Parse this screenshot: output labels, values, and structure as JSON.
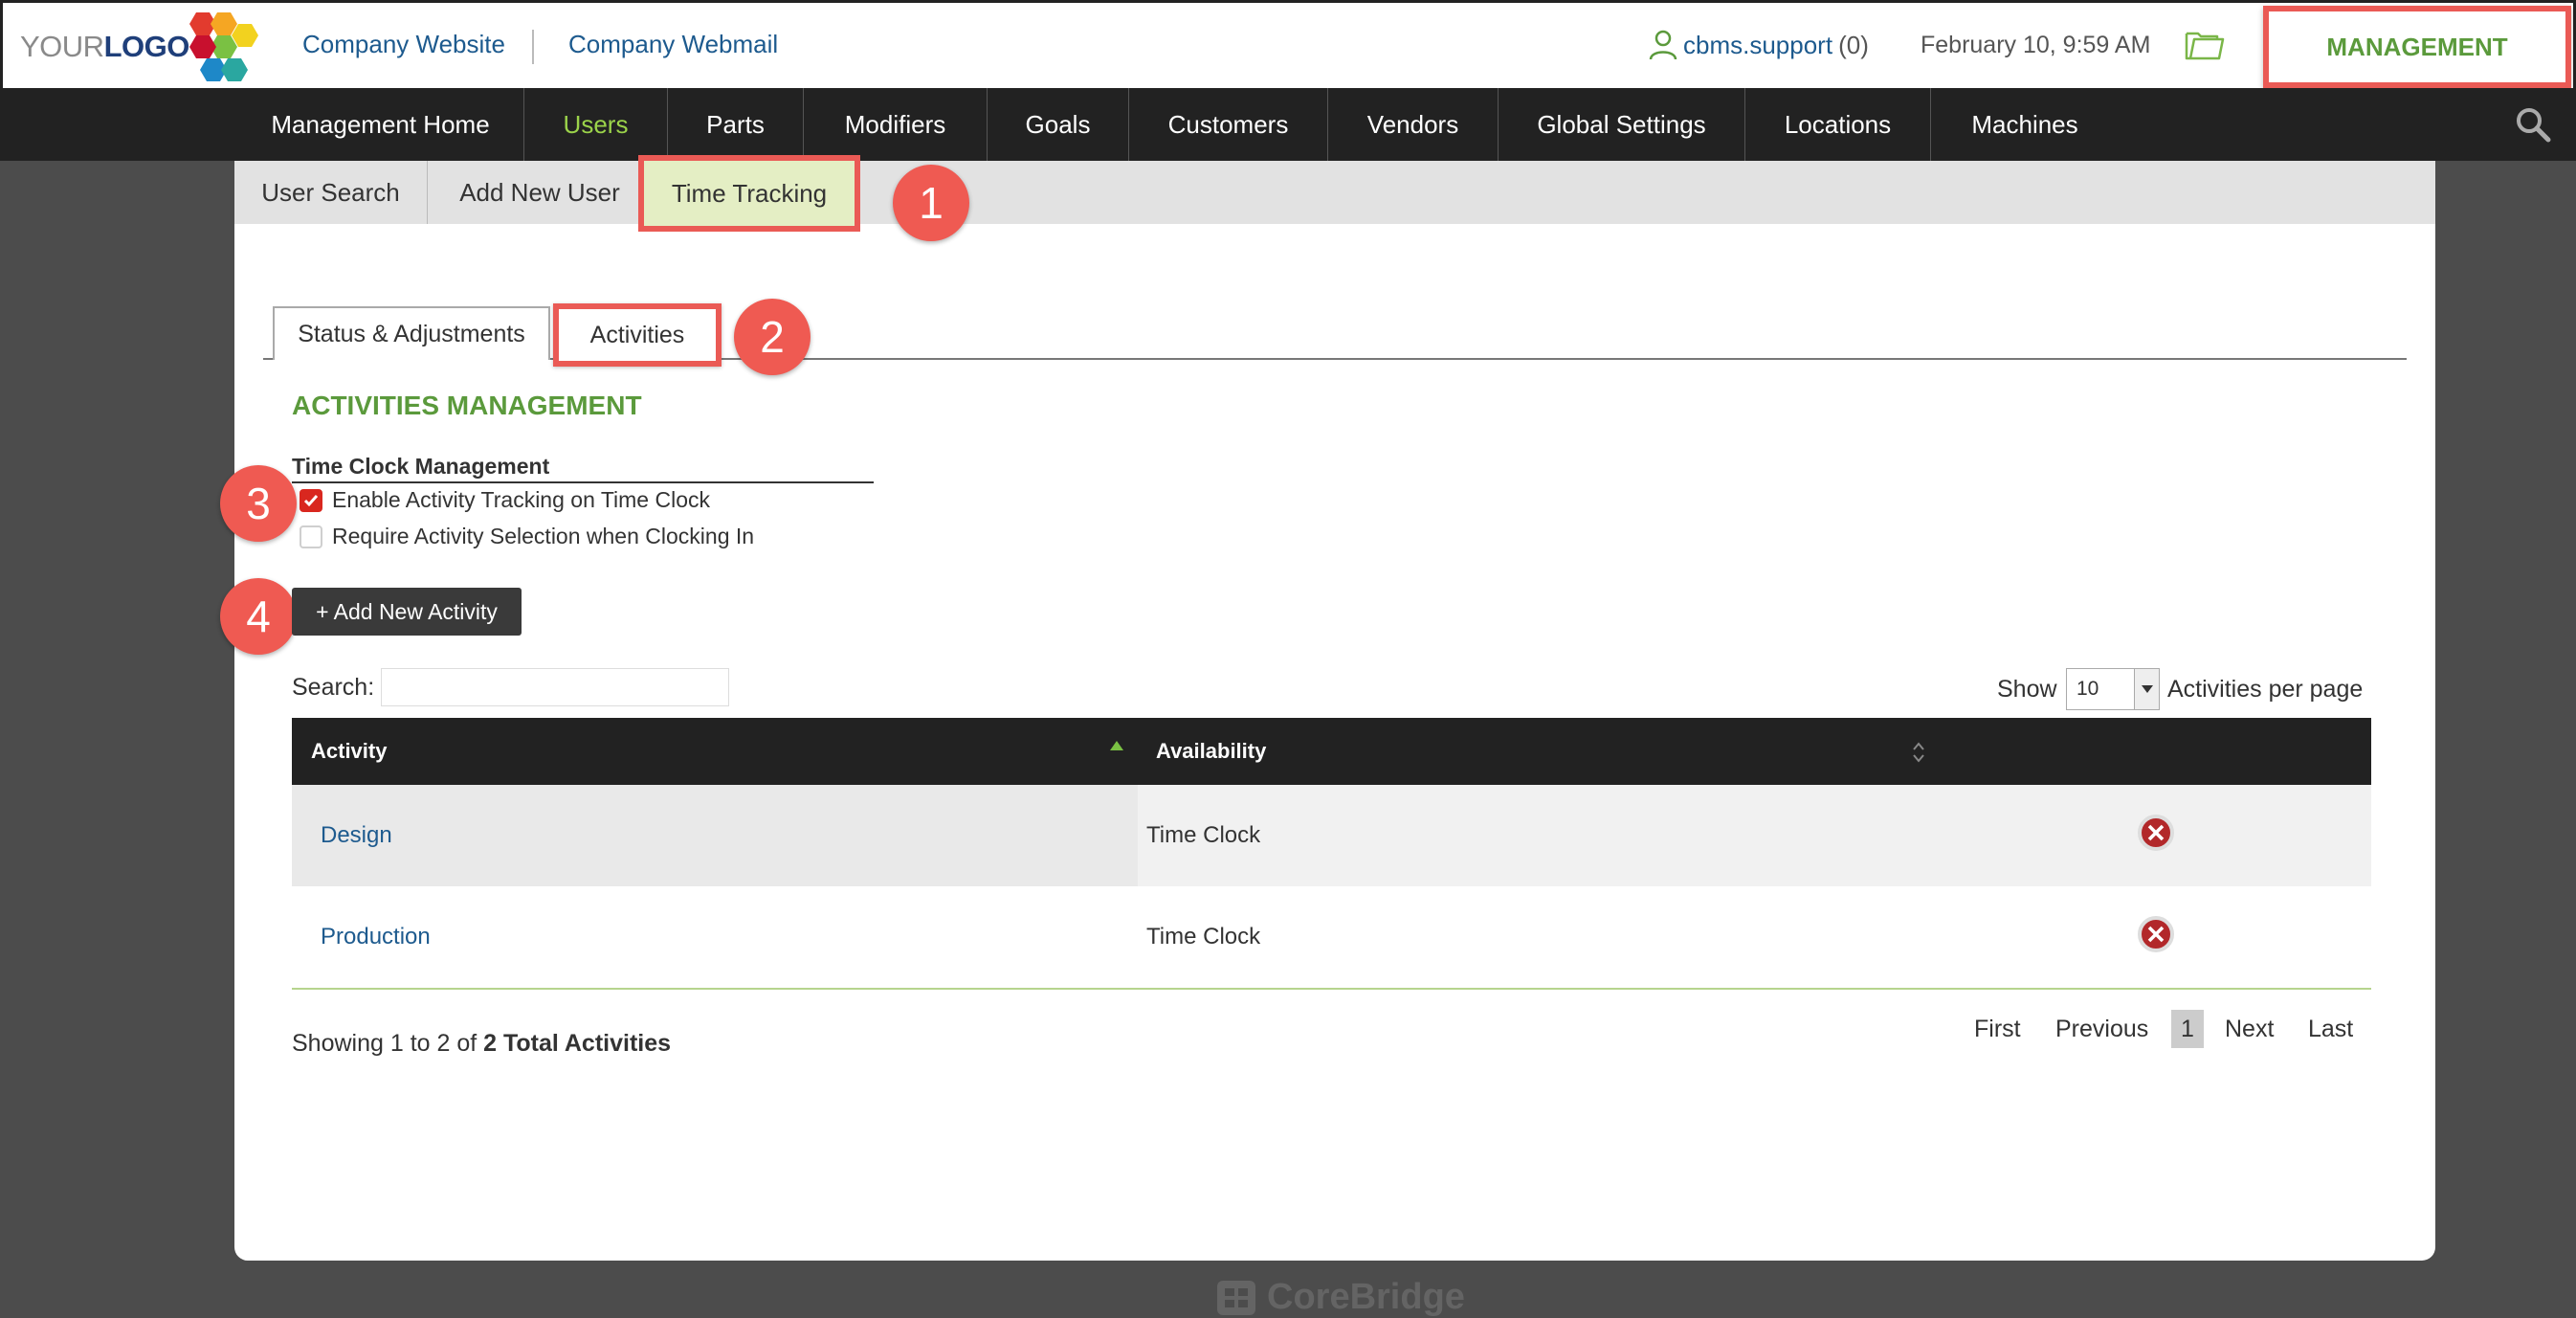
{
  "header": {
    "logo_your": "YOUR",
    "logo_logo": "LOGO",
    "company_website": "Company Website",
    "company_webmail": "Company Webmail",
    "user_name": "cbms.support",
    "user_count": "(0)",
    "datetime": "February 10, 9:59 AM",
    "management": "MANAGEMENT"
  },
  "nav": {
    "items": [
      "Management Home",
      "Users",
      "Parts",
      "Modifiers",
      "Goals",
      "Customers",
      "Vendors",
      "Global Settings",
      "Locations",
      "Machines"
    ],
    "active": "Users"
  },
  "subnav": {
    "items": [
      "User Search",
      "Add New User",
      "Time Tracking"
    ],
    "active": "Time Tracking"
  },
  "tabs": {
    "status": "Status & Adjustments",
    "activities": "Activities"
  },
  "callouts": [
    "1",
    "2",
    "3",
    "4"
  ],
  "section": {
    "title": "ACTIVITIES MANAGEMENT",
    "subheading": "Time Clock Management",
    "option_enable": "Enable Activity Tracking on Time Clock",
    "option_enable_checked": true,
    "option_require": "Require Activity Selection when Clocking In",
    "option_require_checked": false,
    "add_button": "+ Add New Activity"
  },
  "table_controls": {
    "search_label": "Search:",
    "search_value": "",
    "show_label": "Show",
    "page_size": "10",
    "per_page_label": "Activities per page"
  },
  "table": {
    "columns": [
      "Activity",
      "Availability"
    ],
    "rows": [
      {
        "activity": "Design",
        "availability": "Time Clock"
      },
      {
        "activity": "Production",
        "availability": "Time Clock"
      }
    ]
  },
  "footer_info": {
    "prefix": "Showing 1 to 2 of ",
    "total": "2 Total Activities"
  },
  "pager": {
    "first": "First",
    "previous": "Previous",
    "current": "1",
    "next": "Next",
    "last": "Last"
  },
  "brand": "CoreBridge",
  "colors": {
    "accent_green": "#5b9a3c",
    "nav_active": "#9bd34a",
    "callout_red": "#ef5a52",
    "link_blue": "#1d5a8e"
  }
}
